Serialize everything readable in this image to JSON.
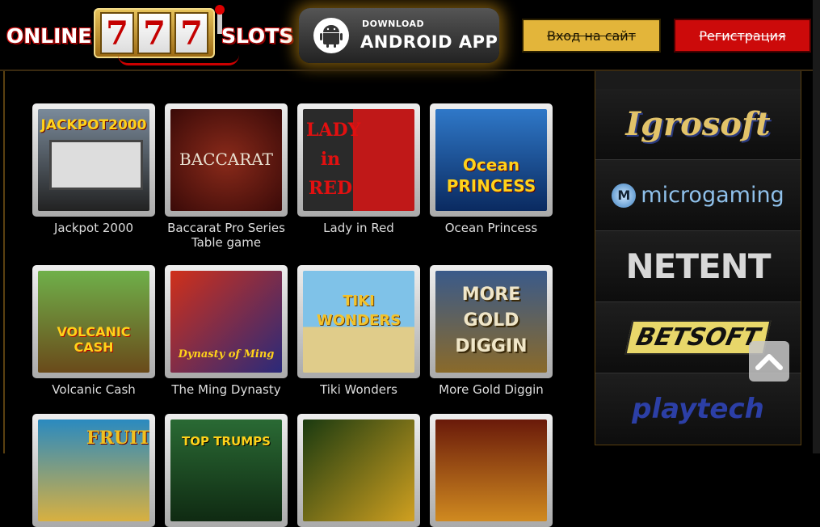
{
  "header": {
    "logo": {
      "left_word": "ONLINE",
      "reels": [
        "7",
        "7",
        "7"
      ],
      "right_word": "SLOTS"
    },
    "android": {
      "small": "DOWNLOAD",
      "big": "ANDROID APP",
      "icon": "android-icon"
    },
    "login_label": "Вход на сайт",
    "register_label": "Регистрация"
  },
  "games": [
    {
      "title": "Jackpot 2000",
      "art": "JACKPOT2000",
      "colors": [
        "#6a7a8a",
        "#222"
      ]
    },
    {
      "title": "Baccarat Pro Series Table game",
      "art": "BACCARAT",
      "colors": [
        "#7a1a14",
        "#3a0a08"
      ]
    },
    {
      "title": "Lady in Red",
      "art": "LADY in RED",
      "colors": [
        "#2a2a2a",
        "#c01010"
      ]
    },
    {
      "title": "Ocean Princess",
      "art": "Ocean PRINCESS",
      "colors": [
        "#1f5fb8",
        "#0a2a60"
      ]
    },
    {
      "title": "Volcanic Cash",
      "art": "VOLCANIC CASH",
      "colors": [
        "#5aa23a",
        "#6a4a1a"
      ]
    },
    {
      "title": "The Ming Dynasty",
      "art": "Dynasty of Ming",
      "colors": [
        "#c0281a",
        "#2a2a7a"
      ]
    },
    {
      "title": "Tiki Wonders",
      "art": "TIKI WONDERS",
      "colors": [
        "#6fb2d8",
        "#d8c27a"
      ]
    },
    {
      "title": "More Gold Diggin",
      "art": "MORE GOLD DIGGIN",
      "colors": [
        "#3a5a8a",
        "#8a6a2a"
      ]
    },
    {
      "title": "",
      "art": "FRUIT",
      "colors": [
        "#2a8ac0",
        "#d8b040"
      ]
    },
    {
      "title": "",
      "art": "TOP TRUMPS",
      "colors": [
        "#1f5a2a",
        "#0f2a12"
      ]
    },
    {
      "title": "",
      "art": "",
      "colors": [
        "#1a3a10",
        "#d0a020"
      ]
    },
    {
      "title": "",
      "art": "",
      "colors": [
        "#6a1a0a",
        "#d08a20"
      ]
    }
  ],
  "providers": [
    "Igrosoft",
    "microgaming",
    "NETENT",
    "BETSOFT",
    "playtech"
  ],
  "scroll_top": {
    "icon": "chevron-up-icon"
  }
}
